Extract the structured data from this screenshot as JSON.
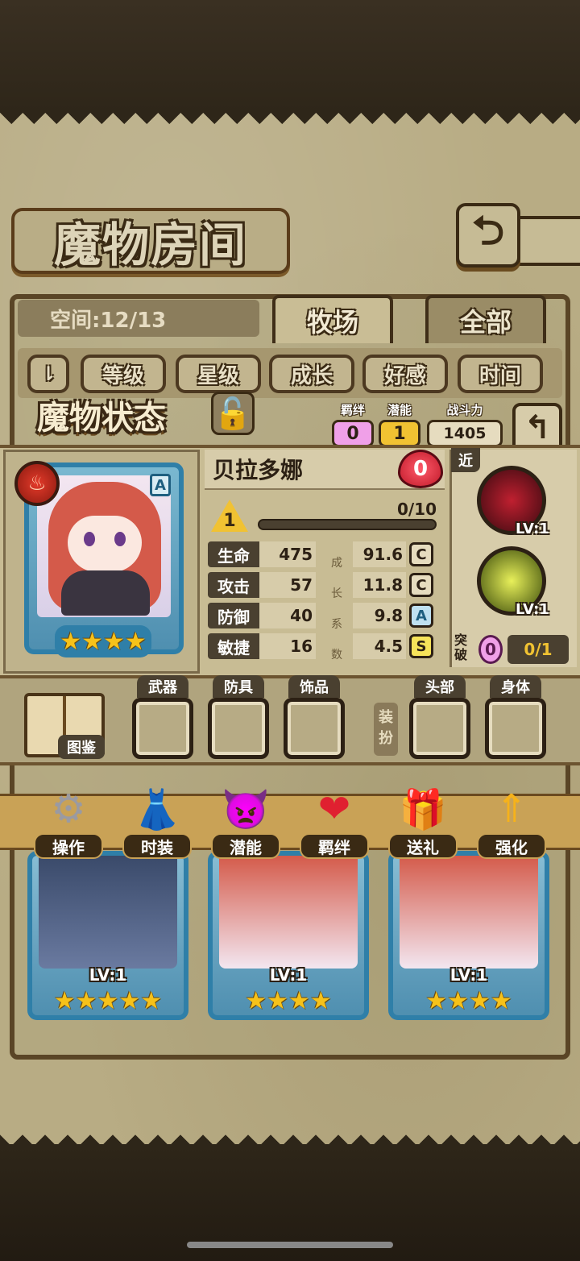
{
  "header": {
    "title": "魔物房间",
    "back_icon": "return-arrow-icon"
  },
  "storage": {
    "space_label": "空间:12/13"
  },
  "tabs": [
    {
      "label": "牧场",
      "active": true
    },
    {
      "label": "全部",
      "active": false
    }
  ],
  "filters": {
    "sort_icon": "sort-order-icon",
    "sort_label": "⇂",
    "items": [
      "等级",
      "星级",
      "成长",
      "好感",
      "时间"
    ]
  },
  "status": {
    "title": "魔物状态",
    "lock_icon": "padlock-icon",
    "bond": {
      "label": "羁绊",
      "value": "0"
    },
    "potential": {
      "label": "潜能",
      "value": "1"
    },
    "power": {
      "label": "战斗力",
      "value": "1405"
    }
  },
  "monster": {
    "name": "贝拉多娜",
    "element_icon": "fire-element-icon",
    "rank": "A",
    "stars": "★★★★",
    "star_count": 4,
    "affection": "0",
    "level": "1",
    "exp": "0/10",
    "exp_fraction": 0.0,
    "growth_label": [
      "成",
      "长",
      "系",
      "数"
    ],
    "stats": [
      {
        "name": "生命",
        "value": "475",
        "growth": "91.6",
        "rank": "C"
      },
      {
        "name": "攻击",
        "value": "57",
        "growth": "11.8",
        "rank": "C"
      },
      {
        "name": "防御",
        "value": "40",
        "growth": "9.8",
        "rank": "A"
      },
      {
        "name": "敏捷",
        "value": "16",
        "growth": "4.5",
        "rank": "S"
      }
    ]
  },
  "skills": {
    "range_tag": "近",
    "items": [
      {
        "icon": "bat-wings-skill-icon",
        "level": "LV:1"
      },
      {
        "icon": "lightning-slash-skill-icon",
        "level": "LV:1"
      }
    ],
    "breakthrough_label": "突破",
    "breakthrough_gem": "0",
    "breakthrough_value": "0/1"
  },
  "equipment": {
    "book_label": "图鉴",
    "slots": [
      "武器",
      "防具",
      "饰品",
      "头部",
      "身体"
    ],
    "switch_label": "装扮"
  },
  "actions": [
    {
      "label": "操作",
      "icon": "gear-icon"
    },
    {
      "label": "时装",
      "icon": "outfit-icon"
    },
    {
      "label": "潜能",
      "icon": "demon-icon"
    },
    {
      "label": "羁绊",
      "icon": "hearts-icon"
    },
    {
      "label": "送礼",
      "icon": "gift-icon"
    },
    {
      "label": "强化",
      "icon": "upgrade-arrows-icon"
    }
  ],
  "monster_list": [
    {
      "level": "LV:1",
      "stars": "★★★★★"
    },
    {
      "level": "LV:1",
      "stars": "★★★★"
    },
    {
      "level": "LV:1",
      "stars": "★★★★"
    }
  ],
  "colors": {
    "parchment": "#b8ac84",
    "card_blue": "#2f7fa8",
    "star_gold": "#f6c21a",
    "bond_pink": "#f0a0e8",
    "potential_yellow": "#f1c232",
    "rank_C": "#e6dcbf",
    "rank_A": "#bfe0f0",
    "rank_S": "#f6e35a"
  }
}
